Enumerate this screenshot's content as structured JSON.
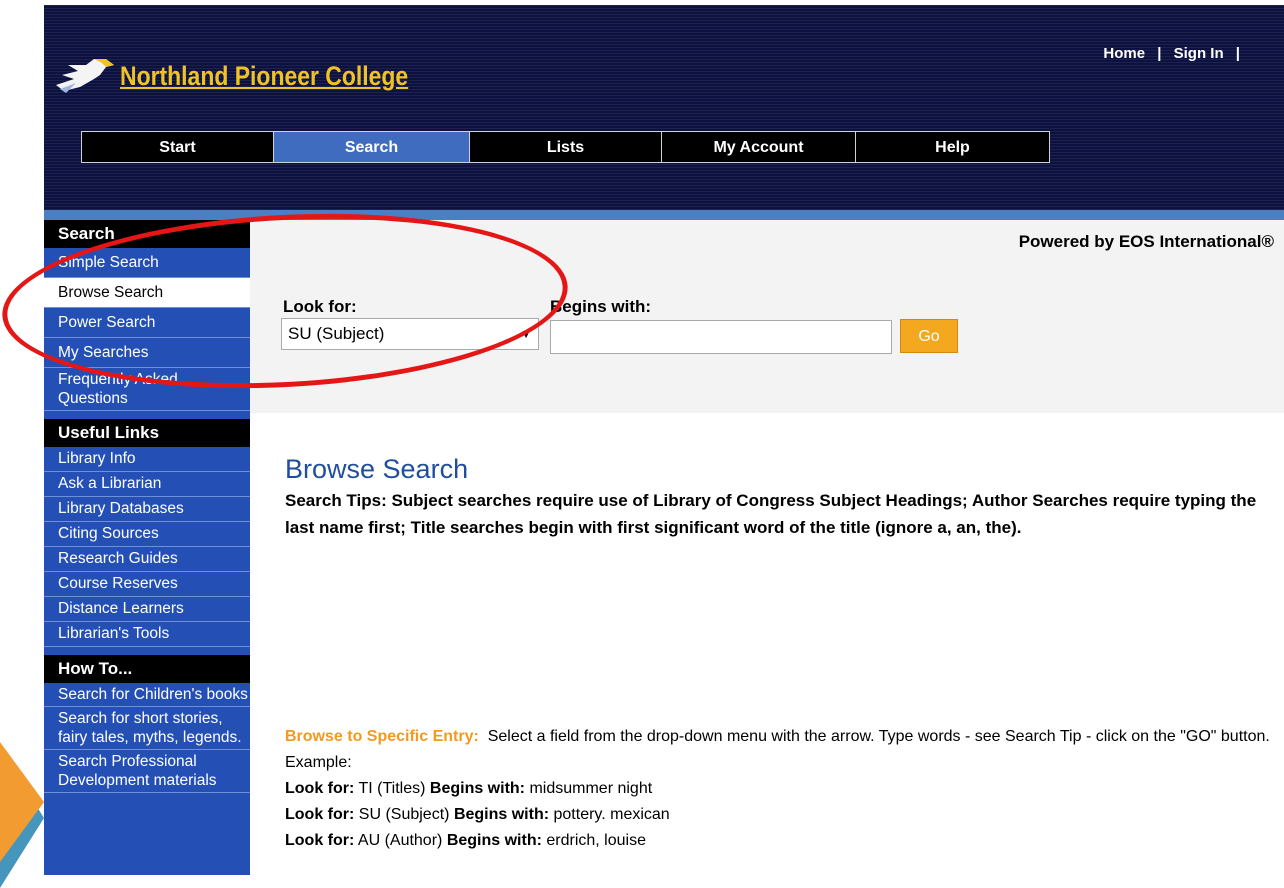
{
  "header": {
    "college_name": "Northland Pioneer College",
    "top_links": {
      "home": "Home",
      "sep1": "|",
      "sign_in": "Sign In",
      "sep2": "|"
    }
  },
  "nav": {
    "tabs": [
      "Start",
      "Search",
      "Lists",
      "My Account",
      "Help"
    ],
    "active": "Search"
  },
  "sidebar": {
    "search_heading": "Search",
    "search_items": [
      "Simple Search",
      "Browse Search",
      "Power Search",
      "My Searches",
      "Frequently Asked Questions"
    ],
    "selected": "Browse Search",
    "useful_heading": "Useful Links",
    "useful_items": [
      "Library Info",
      "Ask a Librarian",
      "Library Databases",
      "Citing Sources",
      "Research Guides",
      "Course Reserves",
      "Distance Learners",
      "Librarian's Tools"
    ],
    "howto_heading": "How To...",
    "howto_items": [
      "Search for Children's books",
      "Search for short stories, fairy tales, myths, legends.",
      "Search Professional Development materials"
    ]
  },
  "search_panel": {
    "powered_by": "Powered by EOS International®",
    "look_for_label": "Look for:",
    "look_for_value": "SU (Subject)",
    "begins_with_label": "Begins with:",
    "begins_with_value": "",
    "go_label": "Go"
  },
  "main": {
    "title": "Browse Search",
    "tips": "Search Tips: Subject searches require use of Library of Congress Subject Headings; Author Searches require typing the last name first; Title searches begin with first significant word of the title (ignore a, an, the).",
    "specific_heading": "Browse to Specific Entry:",
    "specific_text": "Select a field from the drop-down menu with the arrow. Type words - see Search Tip - click on the \"GO\" button. Example:",
    "examples": [
      {
        "look_for_label": "Look for:",
        "field": "TI (Titles)",
        "begins_label": "Begins with:",
        "term": "midsummer night"
      },
      {
        "look_for_label": "Look for:",
        "field": "SU (Subject)",
        "begins_label": "Begins with:",
        "term": "pottery. mexican"
      },
      {
        "look_for_label": "Look for:",
        "field": "AU (Author)",
        "begins_label": "Begins with:",
        "term": "erdrich, louise"
      }
    ]
  },
  "colors": {
    "header_bg": "#0c1140",
    "logo_gold": "#f0c226",
    "sidebar_blue": "#2450b6",
    "active_tab": "#3f6cbf",
    "go_orange": "#f4a81f",
    "circle_red": "#e41616",
    "title_blue": "#1f4e9e"
  }
}
